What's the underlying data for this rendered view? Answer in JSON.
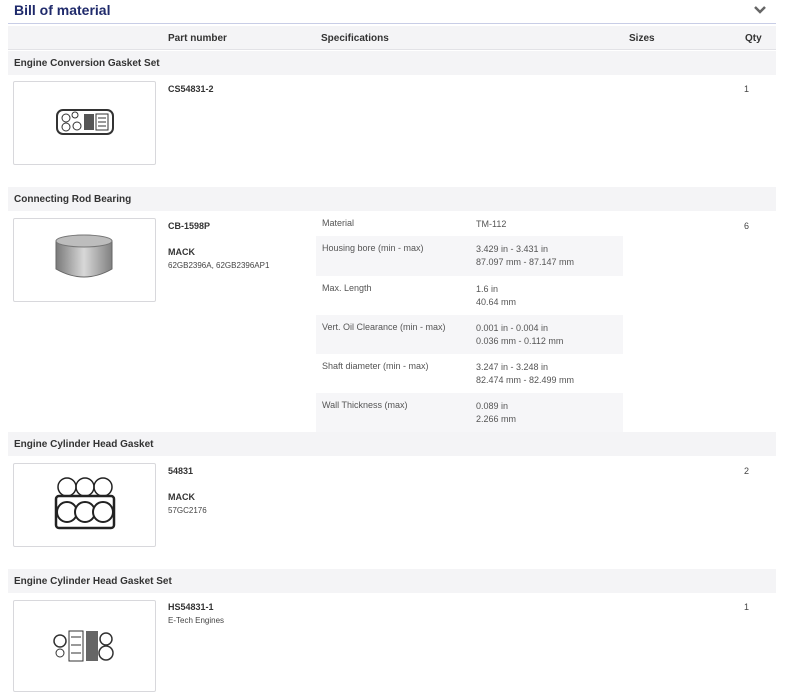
{
  "header": {
    "title": "Bill of material",
    "toggle_icon": "chevron-down-icon"
  },
  "columns": {
    "part_number": "Part number",
    "specifications": "Specifications",
    "sizes": "Sizes",
    "qty": "Qty"
  },
  "items": [
    {
      "section": "Engine Conversion Gasket Set",
      "part_number": "CS54831-2",
      "qty": "1",
      "image": "gasket-set-icon"
    },
    {
      "section": "Connecting Rod Bearing",
      "part_number": "CB-1598P",
      "make": "MACK",
      "make_codes": "62GB2396A, 62GB2396AP1",
      "qty": "6",
      "image": "bearing-icon",
      "specs": [
        {
          "label": "Material",
          "line1": "TM-112",
          "line2": ""
        },
        {
          "label": "Housing bore (min - max)",
          "line1": "3.429 in - 3.431 in",
          "line2": "87.097 mm - 87.147 mm"
        },
        {
          "label": "Max. Length",
          "line1": "1.6 in",
          "line2": "40.64 mm"
        },
        {
          "label": "Vert. Oil Clearance (min - max)",
          "line1": "0.001 in - 0.004 in",
          "line2": "0.036 mm - 0.112 mm"
        },
        {
          "label": "Shaft diameter (min - max)",
          "line1": "3.247 in - 3.248 in",
          "line2": "82.474 mm - 82.499 mm"
        },
        {
          "label": "Wall Thickness (max)",
          "line1": "0.089 in",
          "line2": "2.266 mm"
        }
      ]
    },
    {
      "section": "Engine Cylinder Head Gasket",
      "part_number": "54831",
      "make": "MACK",
      "make_codes": "57GC2176",
      "qty": "2",
      "image": "head-gasket-icon"
    },
    {
      "section": "Engine Cylinder Head Gasket Set",
      "part_number": "HS54831-1",
      "description": "E-Tech Engines",
      "qty": "1",
      "image": "head-gasket-set-icon"
    }
  ]
}
